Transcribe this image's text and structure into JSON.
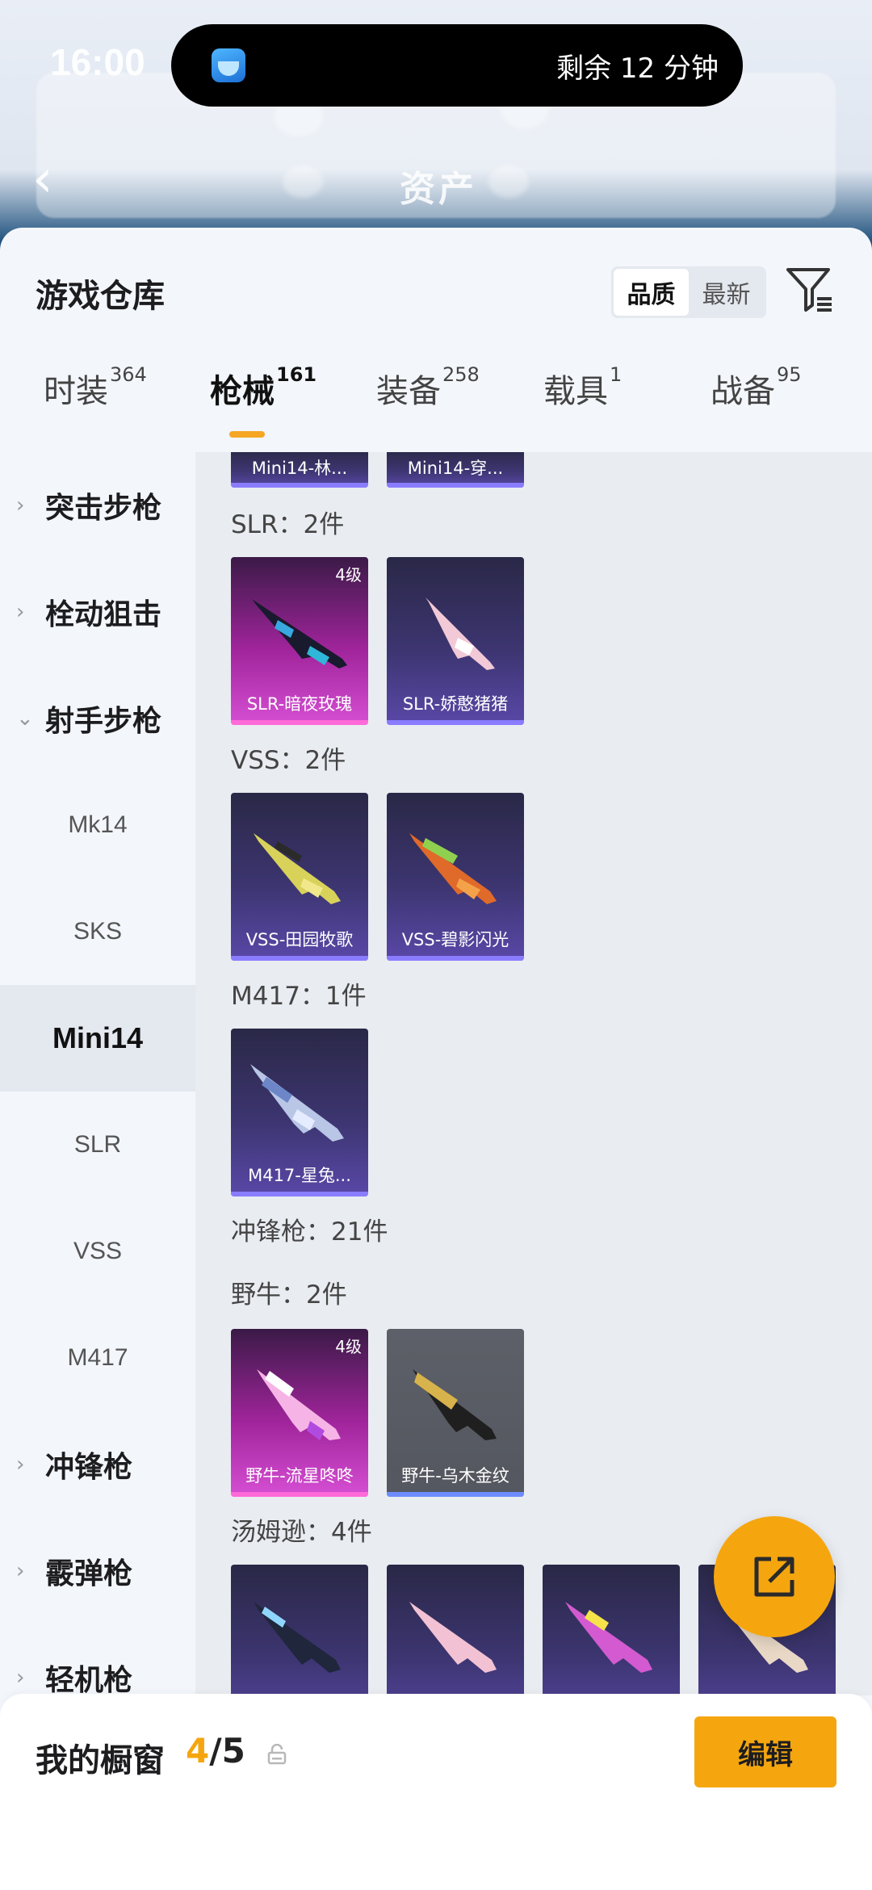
{
  "status_bar": {
    "time": "16:00"
  },
  "dynamic_island": {
    "text": "剩余 12 分钟"
  },
  "background_header": {
    "back_glyph": "‹",
    "title": "资产"
  },
  "sheet": {
    "title": "游戏仓库",
    "sort": {
      "options": [
        "品质",
        "最新"
      ],
      "selected": "品质"
    }
  },
  "tabs": [
    {
      "label": "时装",
      "count": "364"
    },
    {
      "label": "枪械",
      "count": "161",
      "active": true
    },
    {
      "label": "装备",
      "count": "258"
    },
    {
      "label": "载具",
      "count": "1"
    },
    {
      "label": "战备",
      "count": "95"
    }
  ],
  "categories": [
    {
      "label": "突击步枪",
      "type": "group",
      "expanded": false
    },
    {
      "label": "栓动狙击",
      "type": "group",
      "expanded": false
    },
    {
      "label": "射手步枪",
      "type": "group",
      "expanded": true
    },
    {
      "label": "Mk14",
      "type": "sub"
    },
    {
      "label": "SKS",
      "type": "sub"
    },
    {
      "label": "Mini14",
      "type": "sub",
      "selected": true
    },
    {
      "label": "SLR",
      "type": "sub"
    },
    {
      "label": "VSS",
      "type": "sub"
    },
    {
      "label": "M417",
      "type": "sub"
    },
    {
      "label": "冲锋枪",
      "type": "group",
      "expanded": false
    },
    {
      "label": "霰弹枪",
      "type": "group",
      "expanded": false
    },
    {
      "label": "轻机枪",
      "type": "group",
      "expanded": false
    }
  ],
  "content": {
    "partial_items": [
      "Mini14-林...",
      "Mini14-穿..."
    ],
    "groups": [
      {
        "label": "SLR：2件",
        "items": [
          {
            "name": "SLR-暗夜玫瑰",
            "level": "4级",
            "rarity": "pink"
          },
          {
            "name": "SLR-娇憨猪猪",
            "rarity": "purple"
          }
        ]
      },
      {
        "label": "VSS：2件",
        "items": [
          {
            "name": "VSS-田园牧歌",
            "rarity": "purple"
          },
          {
            "name": "VSS-碧影闪光",
            "rarity": "purple"
          }
        ]
      },
      {
        "label": "M417：1件",
        "items": [
          {
            "name": "M417-星兔...",
            "rarity": "purple"
          }
        ]
      },
      {
        "label": "冲锋枪：21件",
        "items": []
      },
      {
        "label": "野牛：2件",
        "items": [
          {
            "name": "野牛-流星咚咚",
            "level": "4级",
            "rarity": "pink"
          },
          {
            "name": "野牛-乌木金纹",
            "rarity": "grey"
          }
        ]
      },
      {
        "label": "汤姆逊：4件",
        "items": [
          {
            "name": "",
            "rarity": "purple"
          },
          {
            "name": "",
            "rarity": "purple"
          },
          {
            "name": "",
            "rarity": "purple"
          },
          {
            "name": "",
            "rarity": "purple"
          }
        ]
      }
    ]
  },
  "bottom_bar": {
    "title": "我的橱窗",
    "current": "4",
    "total": "/5",
    "edit_label": "编辑"
  },
  "colors": {
    "accent": "#f5a60f",
    "tab_underline": "#f5a623",
    "sheet_bg": "#f3f6fb",
    "content_bg": "#e9ecf1"
  }
}
